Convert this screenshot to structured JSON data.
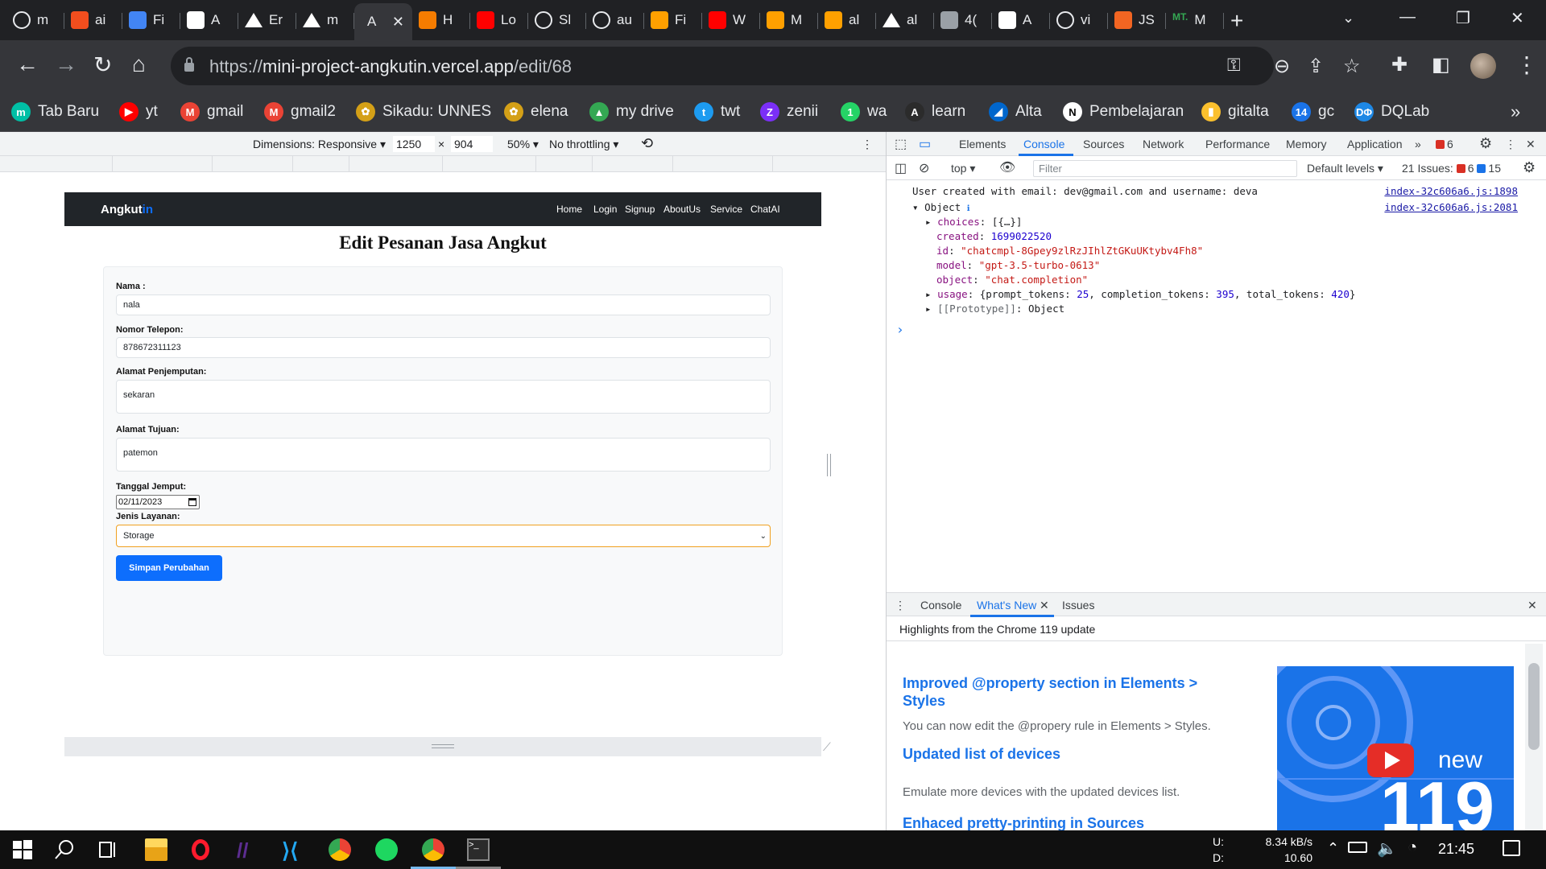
{
  "browser": {
    "tabs": [
      {
        "title": "m",
        "icon": "github-icon",
        "color": "#e8eaed"
      },
      {
        "title": "ai",
        "icon": "figma-icon",
        "color": "#f24e1e"
      },
      {
        "title": "Fi",
        "icon": "docs-icon",
        "color": "#4285f4"
      },
      {
        "title": "A",
        "icon": "page-icon",
        "color": "#ffffff"
      },
      {
        "title": "Er",
        "icon": "vercel-icon",
        "color": "#ffffff"
      },
      {
        "title": "m",
        "icon": "vercel-icon",
        "color": "#ffffff"
      },
      {
        "title": "A",
        "icon": "none",
        "color": "#35363a"
      },
      {
        "title": "H",
        "icon": "udemy-icon",
        "color": "#f57c00"
      },
      {
        "title": "Lo",
        "icon": "youtube-icon",
        "color": "#ff0000"
      },
      {
        "title": "Sl",
        "icon": "github-icon",
        "color": "#e8eaed"
      },
      {
        "title": "au",
        "icon": "github-icon",
        "color": "#e8eaed"
      },
      {
        "title": "Fi",
        "icon": "firebase-icon",
        "color": "#ffa000"
      },
      {
        "title": "W",
        "icon": "youtube-icon",
        "color": "#ff0000"
      },
      {
        "title": "M",
        "icon": "firebase-icon",
        "color": "#ffa000"
      },
      {
        "title": "al",
        "icon": "firebase-icon",
        "color": "#ffa000"
      },
      {
        "title": "al",
        "icon": "vercel-icon",
        "color": "#ffffff"
      },
      {
        "title": "4(",
        "icon": "globe-icon",
        "color": "#9aa0a6"
      },
      {
        "title": "A",
        "icon": "page-icon",
        "color": "#ffffff"
      },
      {
        "title": "vi",
        "icon": "github-icon",
        "color": "#e8eaed"
      },
      {
        "title": "JS",
        "icon": "puzzle-icon",
        "color": "#f26522"
      },
      {
        "title": "M",
        "icon": "mt-icon",
        "color": "#202124"
      }
    ],
    "tab_mt_label": "MT.",
    "active_tab_index": 6,
    "url_prefix": "https://",
    "url_host": "mini-project-angkutin.vercel.app",
    "url_path": "/edit/68",
    "bookmarks": [
      {
        "label": "Tab Baru",
        "icon": "m",
        "color": "#00bfa5"
      },
      {
        "label": "yt",
        "icon": "▶",
        "color": "#ff0000"
      },
      {
        "label": "gmail",
        "icon": "M",
        "color": "#ea4335"
      },
      {
        "label": "gmail2",
        "icon": "M",
        "color": "#ea4335"
      },
      {
        "label": "Sikadu: UNNES",
        "icon": "✿",
        "color": "#d4a017"
      },
      {
        "label": "elena",
        "icon": "✿",
        "color": "#d4a017"
      },
      {
        "label": "my drive",
        "icon": "▲",
        "color": "#34a853"
      },
      {
        "label": "twt",
        "icon": "t",
        "color": "#1d9bf0"
      },
      {
        "label": "zenii",
        "icon": "Z",
        "color": "#7b2ff7"
      },
      {
        "label": "wa",
        "icon": "1",
        "color": "#25d366"
      },
      {
        "label": "learn",
        "icon": "A",
        "color": "#2b2b2b"
      },
      {
        "label": "Alta",
        "icon": "◢",
        "color": "#0066cc"
      },
      {
        "label": "Pembelajaran",
        "icon": "N",
        "color": "#ffffff"
      },
      {
        "label": "gitalta",
        "icon": "▮",
        "color": "#fbc02d"
      },
      {
        "label": "gc",
        "icon": "14",
        "color": "#1a73e8"
      },
      {
        "label": "DQLab",
        "icon": "DΦ",
        "color": "#1e88e5"
      }
    ],
    "bookmarks_overflow": "»"
  },
  "device_toolbar": {
    "dimensions_label": "Dimensions: Responsive",
    "width": "1250",
    "times": "×",
    "height": "904",
    "zoom": "50%",
    "throttling": "No throttling"
  },
  "app": {
    "brand_main": "Angkut",
    "brand_accent": "in",
    "nav": [
      "Home",
      "Login",
      "Signup",
      "AboutUs",
      "Service",
      "ChatAI"
    ],
    "title": "Edit Pesanan Jasa Angkut",
    "form": {
      "nama_label": "Nama :",
      "nama_value": "nala",
      "telepon_label": "Nomor Telepon:",
      "telepon_value": "878672311123",
      "jemput_label": "Alamat Penjemputan:",
      "jemput_value": "sekaran",
      "tujuan_label": "Alamat Tujuan:",
      "tujuan_value": "patemon",
      "tanggal_label": "Tanggal Jemput:",
      "tanggal_value": "02/11/2023",
      "layanan_label": "Jenis Layanan:",
      "layanan_value": "Storage",
      "submit_label": "Simpan Perubahan"
    }
  },
  "devtools": {
    "tabs": [
      "Elements",
      "Console",
      "Sources",
      "Network",
      "Performance",
      "Memory",
      "Application"
    ],
    "active_tab": "Console",
    "more": "»",
    "error_count": "6",
    "context": "top",
    "filter_placeholder": "Filter",
    "levels": "Default levels",
    "issues_label": "21 Issues:",
    "issues_errors": "6",
    "issues_info": "15",
    "console": {
      "log_line": "User created with email: dev@gmail.com and username: deva",
      "log_source": "index-32c606a6.js:1898",
      "obj_source": "index-32c606a6.js:2081",
      "obj_label": "Object",
      "choices_key": "choices",
      "choices_val": "[{…}]",
      "created_key": "created",
      "created_val": "1699022520",
      "id_key": "id",
      "id_val": "\"chatcmpl-8Gpey9zlRzJIhlZtGKuUKtybv4Fh8\"",
      "model_key": "model",
      "model_val": "\"gpt-3.5-turbo-0613\"",
      "object_key": "object",
      "object_val": "\"chat.completion\"",
      "usage_key": "usage",
      "usage_open": "{prompt_tokens: ",
      "usage_pt": "25",
      "usage_ct_label": ", completion_tokens: ",
      "usage_ct": "395",
      "usage_tt_label": ", total_tokens: ",
      "usage_tt": "420",
      "usage_close": "}",
      "proto_key": "[[Prototype]]",
      "proto_val": "Object",
      "prompt": "›"
    },
    "drawer": {
      "tabs": [
        "Console",
        "What's New",
        "Issues"
      ],
      "active": "What's New",
      "highlights": "Highlights from the Chrome 119 update",
      "items": [
        {
          "title": "Improved @property section in Elements > Styles",
          "desc": "You can now edit the @propery rule in Elements > Styles."
        },
        {
          "title": "Updated list of devices",
          "desc": "Emulate more devices with the updated devices list."
        },
        {
          "title": "Enhaced pretty-printing in Sources",
          "desc": ""
        }
      ],
      "image_new": "new",
      "image_version": "119"
    }
  },
  "taskbar": {
    "upload_label": "U:",
    "upload_rate": "8.34 kB/s",
    "download_label": "D:",
    "download_rate": "10.60 kB/s",
    "time": "21:45"
  }
}
